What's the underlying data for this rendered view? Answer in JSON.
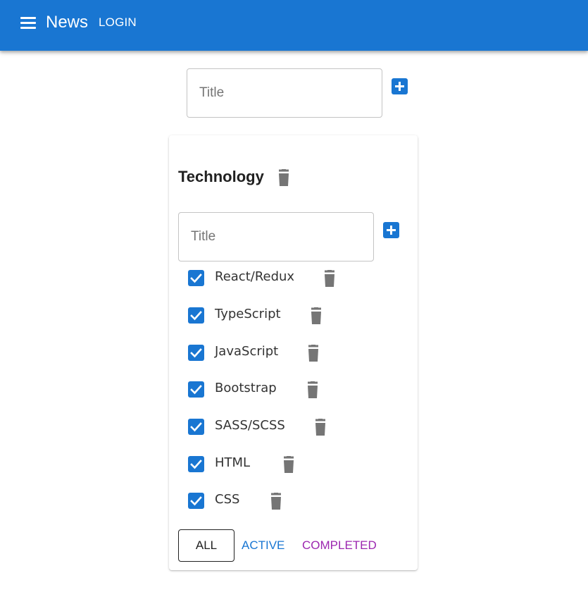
{
  "appbar": {
    "title": "News",
    "login_label": "LOGIN",
    "menu_icon": "menu-icon",
    "background": "#1976d2"
  },
  "new_list": {
    "placeholder": "Title",
    "add_icon": "add-box-icon"
  },
  "list": {
    "title": "Technology",
    "delete_icon": "trash-icon",
    "new_item_placeholder": "Title",
    "items": [
      {
        "label": "React/Redux",
        "checked": true
      },
      {
        "label": "TypeScript",
        "checked": true
      },
      {
        "label": "JavaScript",
        "checked": true
      },
      {
        "label": "Bootstrap",
        "checked": true
      },
      {
        "label": "SASS/SCSS",
        "checked": true
      },
      {
        "label": "HTML",
        "checked": true
      },
      {
        "label": "CSS",
        "checked": true
      }
    ]
  },
  "filters": {
    "all": "ALL",
    "active": "ACTIVE",
    "completed": "COMPLETED",
    "selected": "ALL"
  },
  "colors": {
    "primary": "#1976d2",
    "secondary": "#9c27b0",
    "icon_grey": "#757575"
  }
}
